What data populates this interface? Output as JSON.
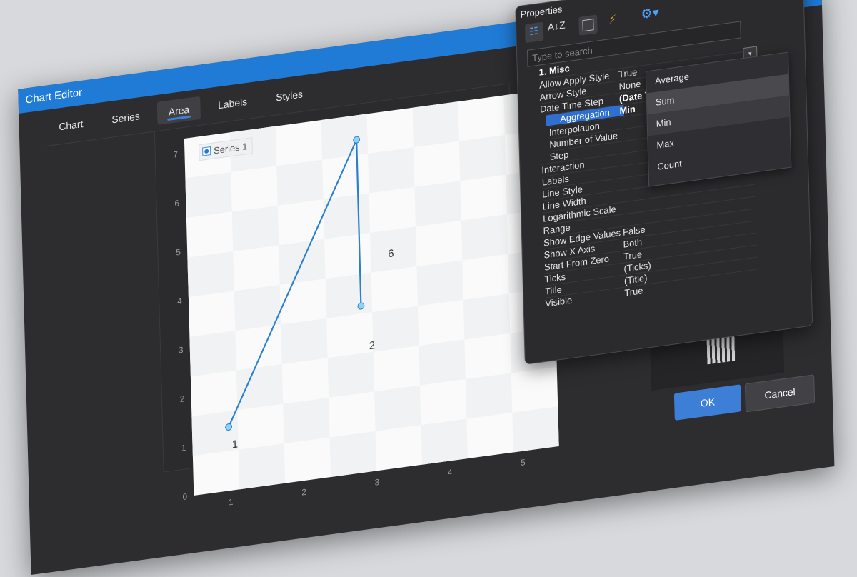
{
  "dialog": {
    "title": "Chart Editor",
    "tabs": [
      "Chart",
      "Series",
      "Area",
      "Labels",
      "Styles"
    ],
    "active_tab": "Area",
    "ok_label": "OK",
    "cancel_label": "Cancel"
  },
  "chart_data": {
    "type": "line",
    "series": [
      {
        "name": "Series 1",
        "points": [
          [
            1,
            1.3,
            "1"
          ],
          [
            2.85,
            6.8,
            "6"
          ],
          [
            2.85,
            3.4,
            "2"
          ]
        ]
      }
    ],
    "x_ticks": [
      "1",
      "2",
      "3",
      "4",
      "5"
    ],
    "y_ticks": [
      "0",
      "1",
      "2",
      "3",
      "4",
      "5",
      "6",
      "7"
    ],
    "xlim": [
      0.5,
      5.5
    ],
    "ylim": [
      0,
      7.3
    ],
    "grid": true,
    "legend_position": "top-left",
    "line_color": "#2a7fcf",
    "marker_color": "#8ed4ee"
  },
  "properties": {
    "title": "Properties",
    "search_placeholder": "Type to search",
    "category": "1. Misc",
    "rows": [
      {
        "name": "Allow Apply Style",
        "value": "True"
      },
      {
        "name": "Arrow Style",
        "value": "None"
      },
      {
        "name": "Date Time Step",
        "value": "(Date Time Step)"
      },
      {
        "name": "Aggregation",
        "value": "Min"
      },
      {
        "name": "Interpolation",
        "value": ""
      },
      {
        "name": "Number of Value",
        "value": ""
      },
      {
        "name": "Step",
        "value": ""
      },
      {
        "name": "Interaction",
        "value": ""
      },
      {
        "name": "Labels",
        "value": ""
      },
      {
        "name": "Line Style",
        "value": ""
      },
      {
        "name": "Line Width",
        "value": ""
      },
      {
        "name": "Logarithmic Scale",
        "value": ""
      },
      {
        "name": "Range",
        "value": ""
      },
      {
        "name": "Show Edge Values",
        "value": "False"
      },
      {
        "name": "Show X Axis",
        "value": "Both"
      },
      {
        "name": "Start From Zero",
        "value": "True"
      },
      {
        "name": "Ticks",
        "value": "(Ticks)"
      },
      {
        "name": "Title",
        "value": "(Title)"
      },
      {
        "name": "Visible",
        "value": "True"
      }
    ],
    "aggregation_options": [
      "Average",
      "Sum",
      "Min",
      "Max",
      "Count"
    ],
    "aggregation_selected": "Min"
  }
}
